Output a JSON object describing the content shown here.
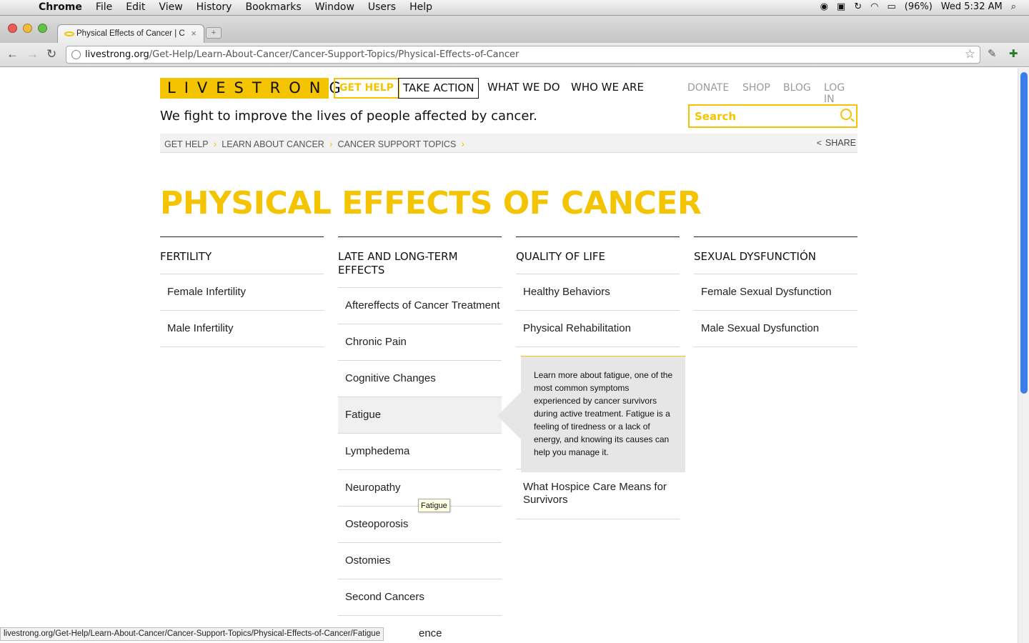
{
  "menubar": {
    "app": "Chrome",
    "menus": [
      "File",
      "Edit",
      "View",
      "History",
      "Bookmarks",
      "Window",
      "Users",
      "Help"
    ],
    "battery": "(96%)",
    "clock": "Wed 5:32 AM"
  },
  "tab": {
    "title": "Physical Effects of Cancer | C"
  },
  "address": {
    "host": "livestrong.org",
    "path": "/Get-Help/Learn-About-Cancer/Cancer-Support-Topics/Physical-Effects-of-Cancer"
  },
  "header": {
    "logo": "LIVESTRONG",
    "nav": {
      "get_help": "GET HELP",
      "take_action": "TAKE ACTION",
      "what_we_do": "WHAT WE DO",
      "who_we_are": "WHO WE ARE"
    },
    "util": {
      "donate": "DONATE",
      "shop": "SHOP",
      "blog": "BLOG",
      "login": "LOG IN"
    },
    "tagline": "We fight to improve the lives of people affected by cancer.",
    "search_placeholder": "Search"
  },
  "breadcrumb": {
    "items": [
      "GET HELP",
      "LEARN ABOUT CANCER",
      "CANCER SUPPORT TOPICS"
    ],
    "share": "SHARE"
  },
  "page": {
    "title": "PHYSICAL EFFECTS OF CANCER"
  },
  "columns": [
    {
      "heading": "FERTILITY",
      "items": [
        "Female Infertility",
        "Male Infertility"
      ]
    },
    {
      "heading": "LATE AND LONG-TERM EFFECTS",
      "items": [
        "Aftereffects of Cancer Treatment",
        "Chronic Pain",
        "Cognitive Changes",
        "Fatigue",
        "Lymphedema",
        "Neuropathy",
        "Osteoporosis",
        "Ostomies",
        "Second Cancers",
        "ence"
      ]
    },
    {
      "heading": "QUALITY OF LIFE",
      "items": [
        "Healthy Behaviors",
        "Physical Rehabilitation",
        "What Hospice Care Means for Survivors"
      ]
    },
    {
      "heading": "SEXUAL DYSFUNCTIÓN",
      "items": [
        "Female Sexual Dysfunction",
        "Male Sexual Dysfunction"
      ]
    }
  ],
  "callout": {
    "text": "Learn more about fatigue, one of the most common symptoms experienced by cancer survivors during active treatment. Fatigue is a feeling of tiredness or a lack of energy, and knowing its causes can help you manage it."
  },
  "tooltip": "Fatigue",
  "status_url": "livestrong.org/Get-Help/Learn-About-Cancer/Cancer-Support-Topics/Physical-Effects-of-Cancer/Fatigue",
  "colors": {
    "brand_yellow": "#f5c400"
  }
}
